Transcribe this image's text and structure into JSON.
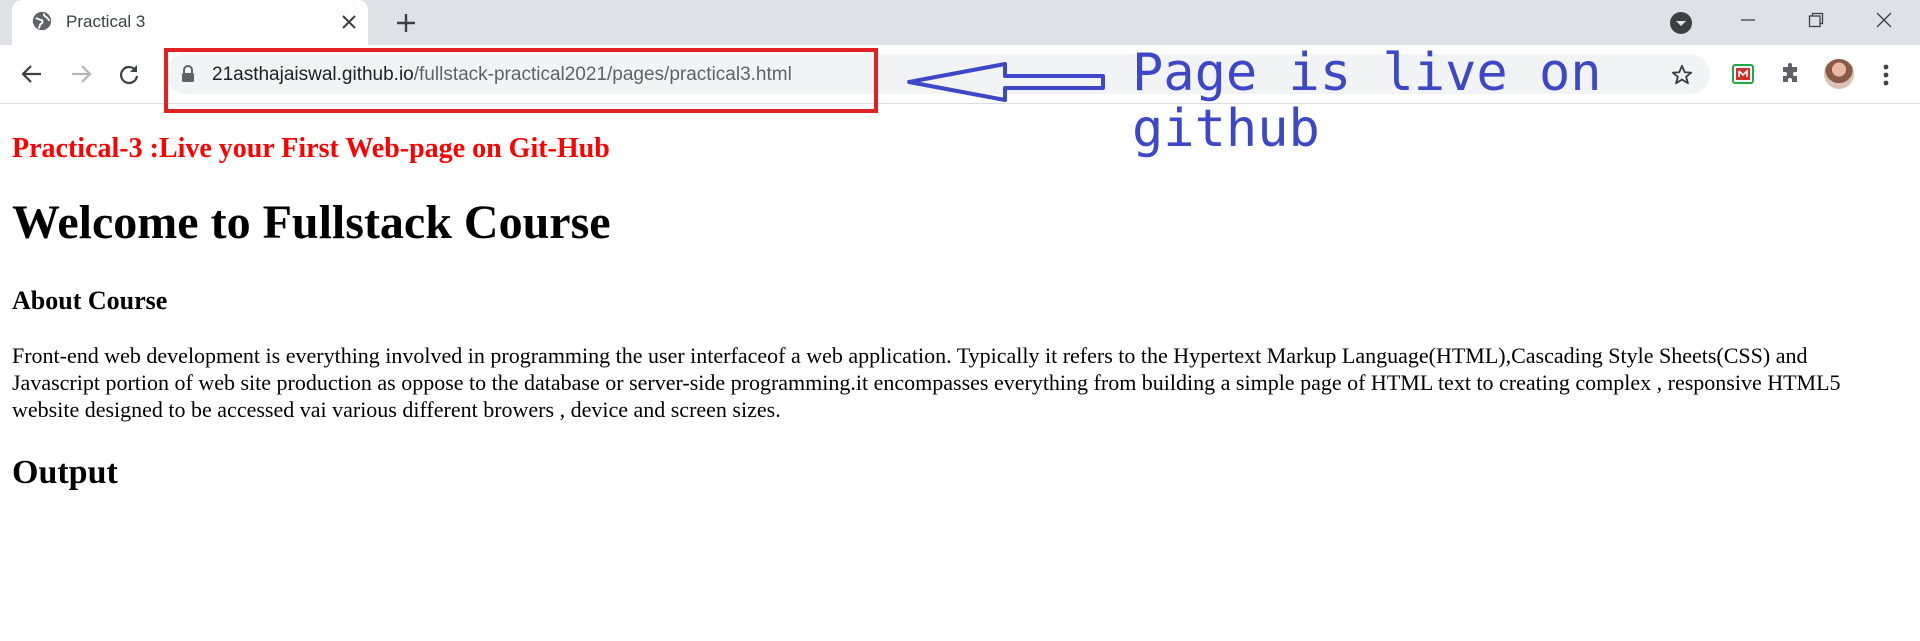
{
  "browser": {
    "tab": {
      "title": "Practical 3"
    },
    "address_bar": {
      "host": "21asthajaiswal.github.io",
      "path": "/fullstack-practical2021/pages/practical3.html"
    }
  },
  "annotation": {
    "text": "Page is live on github",
    "color": "#3c48c8",
    "box_color": "#e22222"
  },
  "page": {
    "practical_title": "Practical-3 :Live your First Web-page on Git-Hub",
    "heading": "Welcome to Fullstack Course",
    "subheading": "About Course",
    "paragraph": "Front-end web development is everything involved in programming the user interfaceof a web application. Typically it refers to the Hypertext Markup Language(HTML),Cascading Style Sheets(CSS) and Javascript portion of web site production as oppose to the database or server-side programming.it encompasses everything from building a simple page of HTML text to creating complex , responsive HTML5 website designed to be accessed vai various different browers , device and screen sizes.",
    "output_heading": "Output"
  },
  "icons": [
    "globe-icon",
    "close-icon",
    "plus-icon",
    "tab-search-icon",
    "minimize-icon",
    "restore-icon",
    "window-close-icon",
    "back-icon",
    "forward-icon",
    "reload-icon",
    "lock-icon",
    "star-icon",
    "extension-icon",
    "puzzle-icon",
    "more-icon",
    "arrow-icon"
  ]
}
